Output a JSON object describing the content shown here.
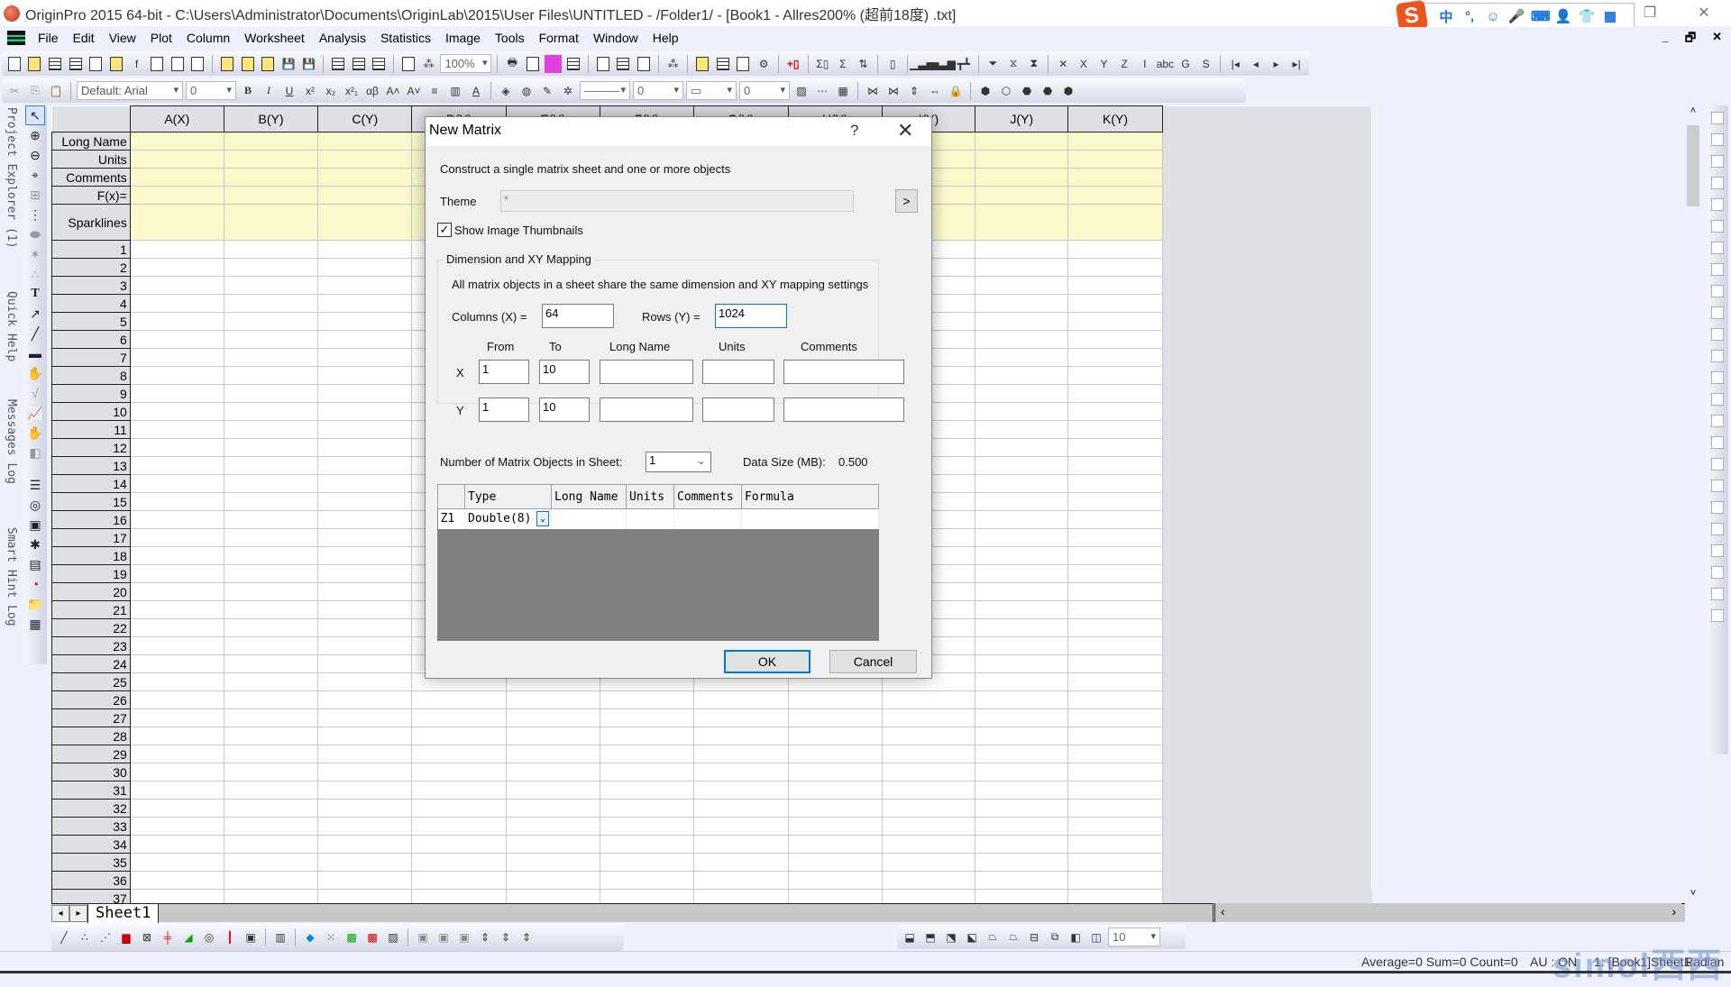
{
  "window": {
    "title": "OriginPro 2015 64-bit - C:\\Users\\Administrator\\Documents\\OriginLab\\2015\\User Files\\UNTITLED - /Folder1/ - [Book1 - Allres200% (超前18度) .txt]",
    "restore_icon": "restore-icon",
    "close_icon": "close-icon"
  },
  "ime_bar": {
    "logo": "S",
    "items": [
      "中",
      "°,",
      "☺",
      "🎤",
      "⌨",
      "👤",
      "👕",
      "▦"
    ]
  },
  "menu": [
    "File",
    "Edit",
    "View",
    "Plot",
    "Column",
    "Worksheet",
    "Analysis",
    "Statistics",
    "Image",
    "Tools",
    "Format",
    "Window",
    "Help"
  ],
  "mdi_controls": [
    "_",
    "🗗",
    "✕"
  ],
  "toolbar": {
    "zoom": "100%",
    "font": "Default: Arial",
    "font_size": "0",
    "line_width": "0",
    "pattern_size": "0",
    "bottom_size": "10"
  },
  "left_panels": [
    "Project Explorer (1)",
    "Quick Help",
    "Messages Log",
    "Smart Hint Log"
  ],
  "worksheet": {
    "columns": [
      "A(X)",
      "B(Y)",
      "C(Y)",
      "D(Y)",
      "E(Y)",
      "F(Y)",
      "G(Y)",
      "H(Y)",
      "I(Y)",
      "J(Y)",
      "K(Y)"
    ],
    "meta_rows": [
      "Long Name",
      "Units",
      "Comments",
      "F(x)=",
      "Sparklines"
    ],
    "row_count": 37,
    "sheet_tab": "Sheet1"
  },
  "dialog": {
    "title": "New Matrix",
    "help": "?",
    "close": "✕",
    "description": "Construct a single matrix sheet and one or more objects",
    "theme_label": "Theme",
    "theme_value": "*",
    "theme_button": ">",
    "show_thumbnails_label": "Show Image Thumbnails",
    "show_thumbnails_checked": true,
    "group_title": "Dimension and XY Mapping",
    "group_note": "All matrix objects in a sheet share the same dimension and  XY mapping settings",
    "columns_label": "Columns (X) =",
    "columns_value": "64",
    "rows_label": "Rows (Y) =",
    "rows_value": "1024",
    "mapping_headers": [
      "From",
      "To",
      "Long Name",
      "Units",
      "Comments"
    ],
    "x_label": "X",
    "x_from": "1",
    "x_to": "10",
    "y_label": "Y",
    "y_from": "1",
    "y_to": "10",
    "num_objects_label": "Number of Matrix Objects in Sheet:",
    "num_objects_value": "1",
    "data_size_label": "Data Size (MB):",
    "data_size_value": "0.500",
    "grid_headers": [
      "",
      "Type",
      "Long Name",
      "Units",
      "Comments",
      "Formula"
    ],
    "grid_rows": [
      {
        "name": "Z1",
        "type": "Double(8)",
        "long_name": "",
        "units": "",
        "comments": "",
        "formula": ""
      }
    ],
    "ok": "OK",
    "cancel": "Cancel"
  },
  "status": {
    "stats": "Average=0 Sum=0 Count=0",
    "au": "AU : ON",
    "sheet": "1: [Book1]Sheet1",
    "angle": "Radian"
  },
  "watermark": "simol西西"
}
